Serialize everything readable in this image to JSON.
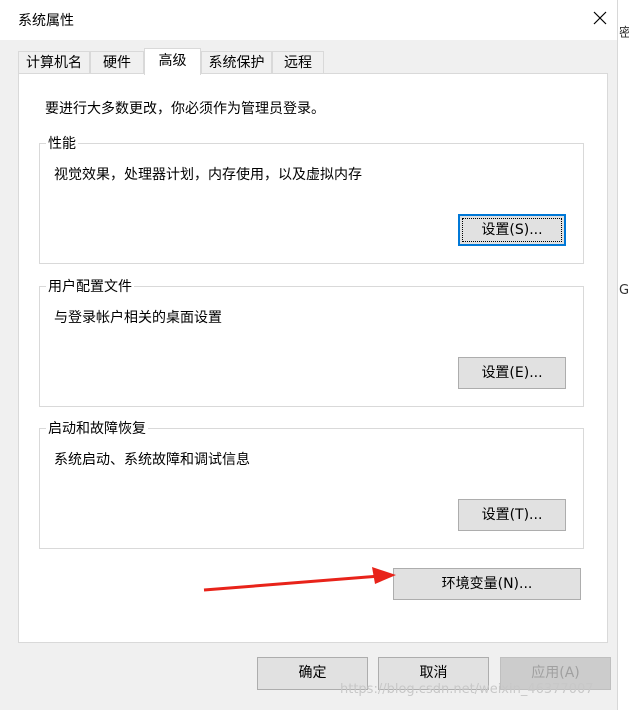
{
  "window": {
    "title": "系统属性"
  },
  "right_strip": {
    "chars": [
      "密",
      "G"
    ]
  },
  "tabs": [
    {
      "label": "计算机名"
    },
    {
      "label": "硬件"
    },
    {
      "label": "高级"
    },
    {
      "label": "系统保护"
    },
    {
      "label": "远程"
    }
  ],
  "note": "要进行大多数更改，你必须作为管理员登录。",
  "groups": {
    "performance": {
      "title": "性能",
      "desc": "视觉效果，处理器计划，内存使用，以及虚拟内存",
      "button": "设置(S)..."
    },
    "profile": {
      "title": "用户配置文件",
      "desc": "与登录帐户相关的桌面设置",
      "button": "设置(E)..."
    },
    "startup": {
      "title": "启动和故障恢复",
      "desc": "系统启动、系统故障和调试信息",
      "button": "设置(T)..."
    }
  },
  "env_button": "环境变量(N)...",
  "footer": {
    "ok": "确定",
    "cancel": "取消",
    "apply": "应用(A)"
  },
  "watermark": "https://blog.csdn.net/weixin_46377007",
  "colors": {
    "accent": "#0078d7",
    "arrow": "#e8231a"
  },
  "icons": {
    "close": "close-icon",
    "annotation": "arrow-annotation"
  }
}
